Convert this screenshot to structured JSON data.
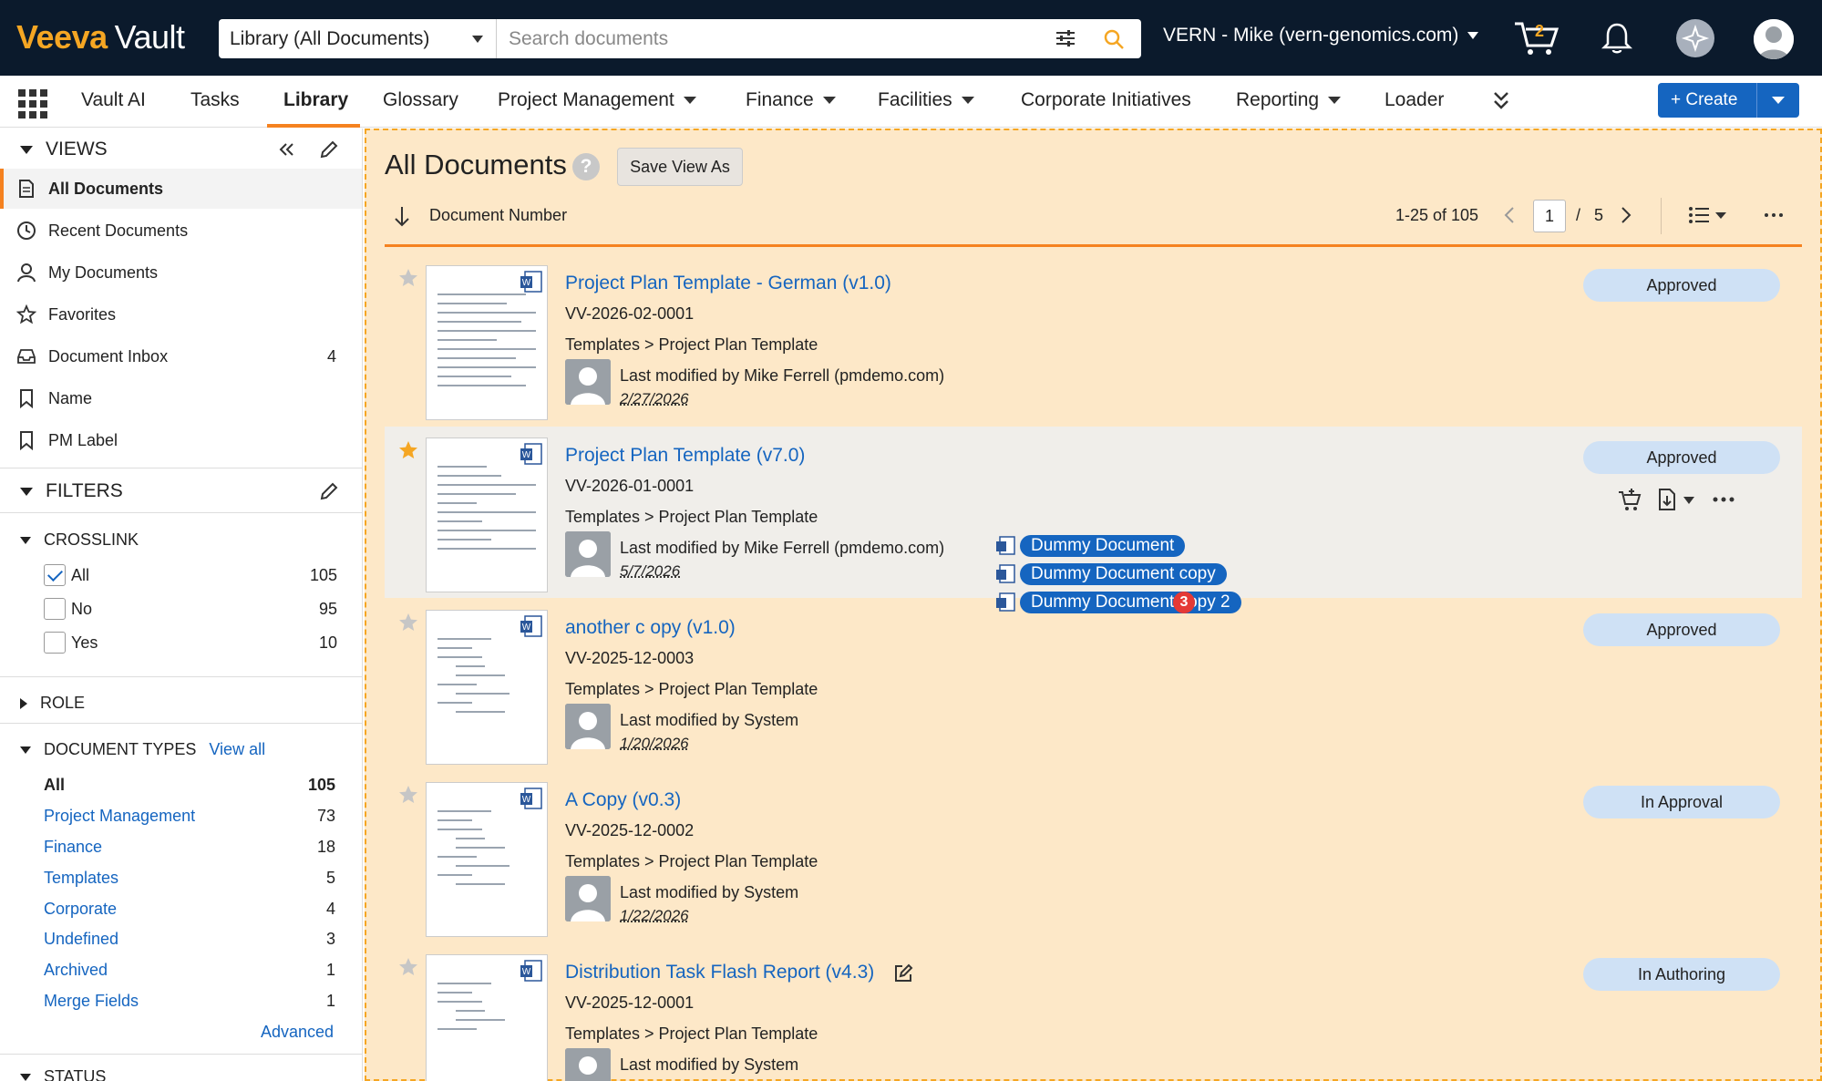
{
  "header": {
    "logo_brand": "Veeva",
    "logo_product": "Vault",
    "scope_select": "Library (All Documents)",
    "search_placeholder": "Search documents",
    "vault_switcher": "VERN - Mike (vern-genomics.com)",
    "cart_count": "2"
  },
  "nav": {
    "items": [
      {
        "label": "Vault AI"
      },
      {
        "label": "Tasks"
      },
      {
        "label": "Library"
      },
      {
        "label": "Glossary"
      },
      {
        "label": "Project Management"
      },
      {
        "label": "Finance"
      },
      {
        "label": "Facilities"
      },
      {
        "label": "Corporate Initiatives"
      },
      {
        "label": "Reporting"
      },
      {
        "label": "Loader"
      }
    ],
    "active": "Library",
    "create_label": "Create"
  },
  "sidebar": {
    "views_title": "VIEWS",
    "views": [
      {
        "label": "All Documents",
        "count": ""
      },
      {
        "label": "Recent Documents",
        "count": ""
      },
      {
        "label": "My Documents",
        "count": ""
      },
      {
        "label": "Favorites",
        "count": ""
      },
      {
        "label": "Document Inbox",
        "count": "4"
      },
      {
        "label": "Name",
        "count": ""
      },
      {
        "label": "PM Label",
        "count": ""
      }
    ],
    "filters_title": "FILTERS",
    "crosslink_title": "CROSSLINK",
    "crosslink": [
      {
        "label": "All",
        "count": "105",
        "checked": true
      },
      {
        "label": "No",
        "count": "95",
        "checked": false
      },
      {
        "label": "Yes",
        "count": "10",
        "checked": false
      }
    ],
    "role_title": "ROLE",
    "doctypes_title": "DOCUMENT TYPES",
    "view_all": "View all",
    "doctypes": [
      {
        "label": "All",
        "count": "105"
      },
      {
        "label": "Project Management",
        "count": "73"
      },
      {
        "label": "Finance",
        "count": "18"
      },
      {
        "label": "Templates",
        "count": "5"
      },
      {
        "label": "Corporate",
        "count": "4"
      },
      {
        "label": "Undefined",
        "count": "3"
      },
      {
        "label": "Archived",
        "count": "1"
      },
      {
        "label": "Merge Fields",
        "count": "1"
      }
    ],
    "advanced": "Advanced",
    "status_title": "STATUS"
  },
  "main": {
    "title": "All Documents",
    "help": "?",
    "save_view": "Save View As",
    "sort_label": "Document Number",
    "range": "1-25 of 105",
    "page": "1",
    "page_sep": "/",
    "pages": "5"
  },
  "documents": [
    {
      "title": "Project Plan Template - German (v1.0)",
      "number": "VV-2026-02-0001",
      "path": "Templates > Project Plan Template",
      "modified": "Last modified by Mike Ferrell (pmdemo.com)",
      "date": "2/27/2026",
      "status": "Approved",
      "favorite": false
    },
    {
      "title": "Project Plan Template (v7.0)",
      "number": "VV-2026-01-0001",
      "path": "Templates > Project Plan Template",
      "modified": "Last modified by Mike Ferrell (pmdemo.com)",
      "date": "5/7/2026",
      "status": "Approved",
      "favorite": true
    },
    {
      "title": "another c opy (v1.0)",
      "number": "VV-2025-12-0003",
      "path": "Templates > Project Plan Template",
      "modified": "Last modified by System",
      "date": "1/20/2026",
      "status": "Approved",
      "favorite": false
    },
    {
      "title": "A Copy (v0.3)",
      "number": "VV-2025-12-0002",
      "path": "Templates > Project Plan Template",
      "modified": "Last modified by System",
      "date": "1/22/2026",
      "status": "In Approval",
      "favorite": false
    },
    {
      "title": "Distribution Task Flash Report (v4.3)",
      "number": "VV-2025-12-0001",
      "path": "Templates > Project Plan Template",
      "modified": "Last modified by System",
      "date": "",
      "status": "In Authoring",
      "favorite": false
    }
  ],
  "drag": {
    "items": [
      "Dummy Document",
      "Dummy Document copy",
      "Dummy Document copy 2"
    ],
    "count": "3"
  },
  "colors": {
    "header_bg": "#0b1a2c",
    "brand_orange": "#f5a623",
    "accent_orange": "#f58220",
    "link_blue": "#1565c0",
    "main_bg": "#fde8c8",
    "status_pill": "#cfe1f5"
  }
}
